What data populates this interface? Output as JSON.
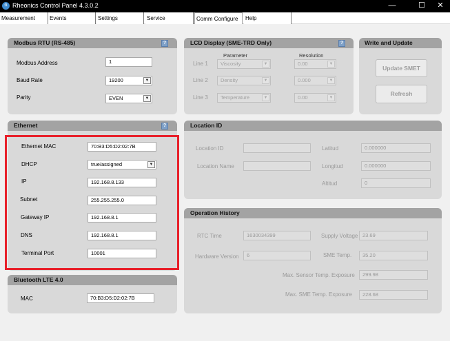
{
  "window": {
    "title": "Rheonics Control Panel 4.3.0.2",
    "app_icon": "rheonics-logo",
    "minimize_glyph": "—",
    "maximize_glyph": "☐",
    "close_glyph": "✕"
  },
  "tabs": [
    "Measurement",
    "Events",
    "Settings",
    "Service",
    "Comm Configure",
    "Help"
  ],
  "active_tab": "Comm Configure",
  "modbus": {
    "title": "Modbus RTU (RS-485)",
    "help": "?",
    "address_label": "Modbus Address",
    "address_value": "1",
    "baud_label": "Baud Rate",
    "baud_value": "19200",
    "parity_label": "Parity",
    "parity_value": "EVEN"
  },
  "lcd": {
    "title": "LCD Display (SME-TRD Only)",
    "help": "?",
    "parameter_header": "Parameter",
    "resolution_header": "Resolution",
    "lines": [
      {
        "label": "Line 1",
        "parameter": "Viscosity",
        "resolution": "0.00"
      },
      {
        "label": "Line 2",
        "parameter": "Density",
        "resolution": "0.000"
      },
      {
        "label": "Line 3",
        "parameter": "Temperature",
        "resolution": "0.00"
      }
    ]
  },
  "write_update": {
    "title": "Write and Update",
    "update_button": "Update SMET",
    "refresh_button": "Refresh"
  },
  "ethernet": {
    "title": "Ethernet",
    "help": "?",
    "mac_label": "Ethernet MAC",
    "mac_value": "70:B3:D5:D2:02:7B",
    "dhcp_label": "DHCP",
    "dhcp_value": "true/assigned",
    "ip_label": "IP",
    "ip_value": "192.168.8.133",
    "subnet_label": "Subnet",
    "subnet_value": "255.255.255.0",
    "gateway_label": "Gateway IP",
    "gateway_value": "192.168.8.1",
    "dns_label": "DNS",
    "dns_value": "192.168.8.1",
    "port_label": "Terminal Port",
    "port_value": "10001",
    "highlight_color": "#e8202a"
  },
  "bluetooth": {
    "title": "Bluetooth LTE 4.0",
    "mac_label": "MAC",
    "mac_value": "70:B3:D5:D2:02:7B"
  },
  "location": {
    "title": "Location ID",
    "location_id_label": "Location ID",
    "location_id_value": "",
    "location_name_label": "Location Name",
    "location_name_value": "",
    "latitude_label": "Latitud",
    "latitude_value": "0.000000",
    "longitude_label": "Longitud",
    "longitude_value": "0.000000",
    "altitude_label": "Altitud",
    "altitude_value": "0"
  },
  "history": {
    "title": "Operation History",
    "rtc_label": "RTC Time",
    "rtc_value": "1630034399",
    "supply_label": "Supply Voltage",
    "supply_value": "23.69",
    "hw_label": "Hardware Version",
    "hw_value": "6",
    "sme_temp_label": "SME Temp.",
    "sme_temp_value": "35.20",
    "max_sensor_label": "Max. Sensor Temp. Exposure",
    "max_sensor_value": "299.98",
    "max_sme_label": "Max. SME Temp. Exposure",
    "max_sme_value": "228.68"
  }
}
